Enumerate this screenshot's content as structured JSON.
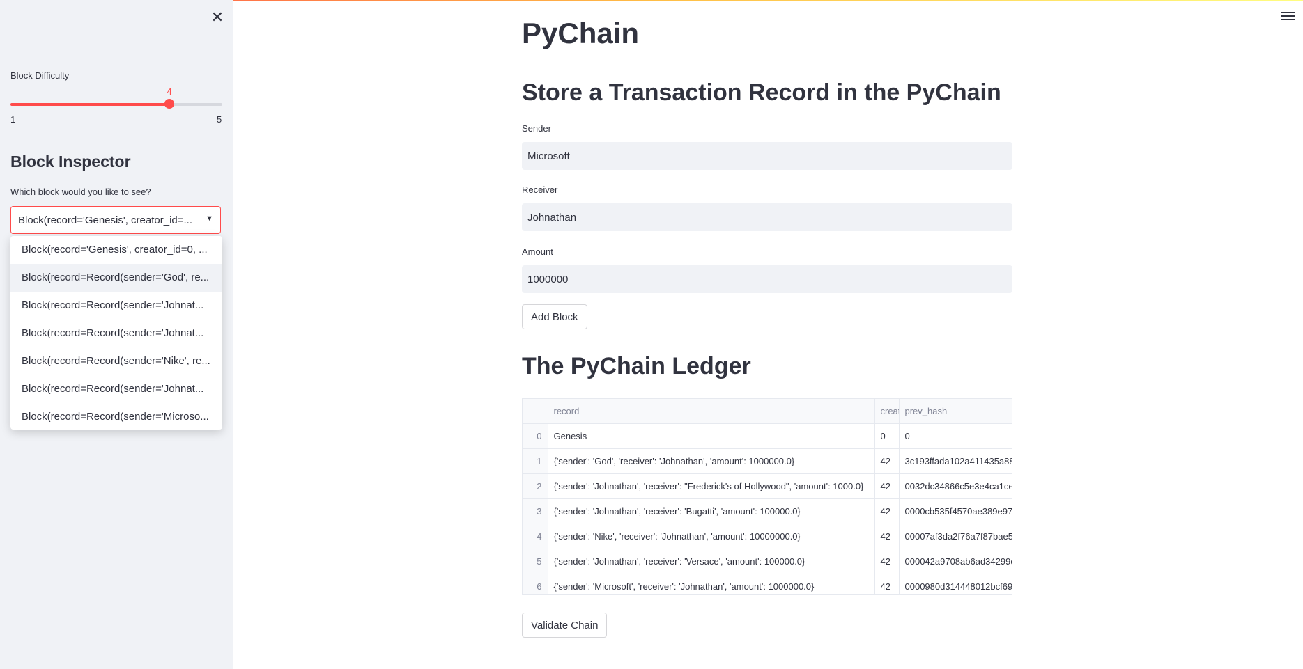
{
  "sidebar": {
    "slider": {
      "label": "Block Difficulty",
      "value": 4,
      "min": 1,
      "max": 5
    },
    "inspector": {
      "heading": "Block Inspector",
      "select_label": "Which block would you like to see?",
      "selected": "Block(record='Genesis', creator_id=...",
      "options": [
        "Block(record='Genesis', creator_id=0, ...",
        "Block(record=Record(sender='God', re...",
        "Block(record=Record(sender='Johnat...",
        "Block(record=Record(sender='Johnat...",
        "Block(record=Record(sender='Nike', re...",
        "Block(record=Record(sender='Johnat...",
        "Block(record=Record(sender='Microso..."
      ]
    }
  },
  "main": {
    "title": "PyChain",
    "form_heading": "Store a Transaction Record in the PyChain",
    "sender": {
      "label": "Sender",
      "value": "Microsoft"
    },
    "receiver": {
      "label": "Receiver",
      "value": "Johnathan"
    },
    "amount": {
      "label": "Amount",
      "value": "1000000"
    },
    "add_block_label": "Add Block",
    "ledger_heading": "The PyChain Ledger",
    "ledger": {
      "columns": [
        "record",
        "creat",
        "prev_hash"
      ],
      "rows": [
        {
          "index": "0",
          "record": "Genesis",
          "creator": "0",
          "prev_hash": "0"
        },
        {
          "index": "1",
          "record": "{'sender': 'God', 'receiver': 'Johnathan', 'amount': 1000000.0}",
          "creator": "42",
          "prev_hash": "3c193ffada102a411435a88"
        },
        {
          "index": "2",
          "record": "{'sender': 'Johnathan', 'receiver': \"Frederick's of Hollywood\", 'amount': 1000.0}",
          "creator": "42",
          "prev_hash": "0032dc34866c5e3e4ca1ce"
        },
        {
          "index": "3",
          "record": "{'sender': 'Johnathan', 'receiver': 'Bugatti', 'amount': 100000.0}",
          "creator": "42",
          "prev_hash": "0000cb535f4570ae389e977"
        },
        {
          "index": "4",
          "record": "{'sender': 'Nike', 'receiver': 'Johnathan', 'amount': 10000000.0}",
          "creator": "42",
          "prev_hash": "00007af3da2f76a7f87bae5"
        },
        {
          "index": "5",
          "record": "{'sender': 'Johnathan', 'receiver': 'Versace', 'amount': 100000.0}",
          "creator": "42",
          "prev_hash": "000042a9708ab6ad34299c"
        },
        {
          "index": "6",
          "record": "{'sender': 'Microsoft', 'receiver': 'Johnathan', 'amount': 1000000.0}",
          "creator": "42",
          "prev_hash": "0000980d314448012bcf695"
        }
      ]
    },
    "validate_label": "Validate Chain"
  },
  "icons": {
    "close": "close-icon",
    "menu": "hamburger-menu-icon",
    "caret": "caret-down-icon"
  },
  "colors": {
    "accent": "#ff4b4b",
    "sidebar_bg": "#f0f2f6",
    "text": "#31333f"
  }
}
